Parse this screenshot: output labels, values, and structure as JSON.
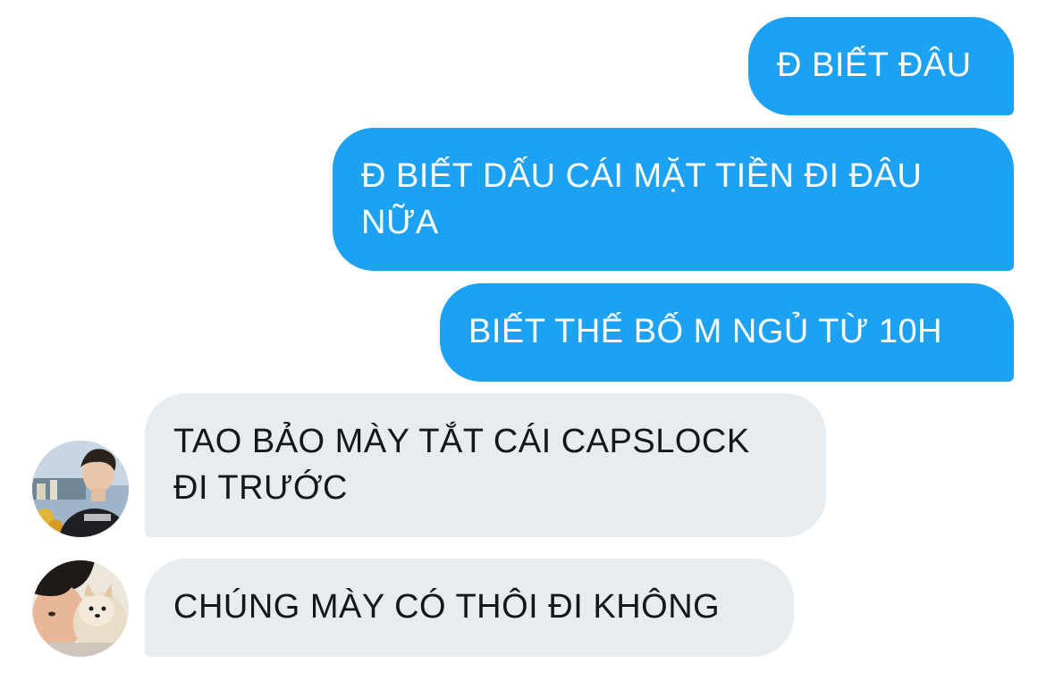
{
  "messages": [
    {
      "direction": "outgoing",
      "text": "Đ BIẾT ĐÂU"
    },
    {
      "direction": "outgoing",
      "text": "Đ BIẾT DẤU CÁI MẶT TIỀN ĐI ĐÂU NỮA"
    },
    {
      "direction": "outgoing",
      "text": "BIẾT THẾ BỐ M NGỦ TỪ 10H"
    },
    {
      "direction": "incoming",
      "text": "TAO BẢO MÀY TẮT CÁI CAPSLOCK ĐI TRƯỚC",
      "avatar": "avatar-young-man-photo"
    },
    {
      "direction": "incoming",
      "text": "CHÚNG MÀY CÓ THÔI ĐI KHÔNG",
      "avatar": "avatar-person-with-dog-photo"
    }
  ],
  "colors": {
    "outgoing_bubble": "#1da1f2",
    "incoming_bubble": "#e6ecf0",
    "outgoing_text": "#ffffff",
    "incoming_text": "#14171a"
  }
}
